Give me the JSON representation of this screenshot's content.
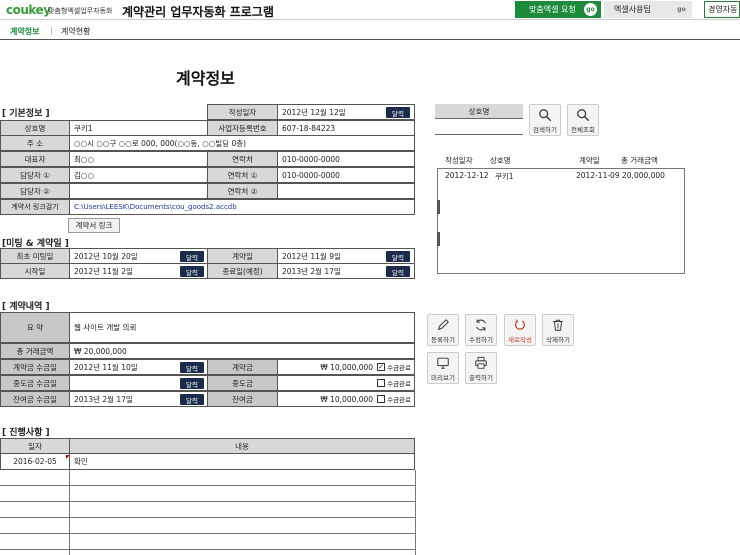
{
  "header": {
    "logo": "coukey",
    "logo_sub": "맞춤형엑셀업무자동화",
    "title": "계약관리 업무자동화 프로그램",
    "btn_custom": "맞춤엑셀 요청",
    "btn_usage": "엑셀사용팁",
    "go": "go",
    "btn_right": "경영자동"
  },
  "tabs": {
    "contract_info": "계약정보",
    "contract_status": "계약현황",
    "sep": "|"
  },
  "page_title": "계약정보",
  "basic": {
    "section": "[ 기본정보 ]",
    "written_date_label": "작성일자",
    "written_date": "2012년 12월 12일",
    "company_label": "상호명",
    "company": "쿠키1",
    "bizno_label": "사업자등록번호",
    "bizno": "607-18-84223",
    "addr_label": "주  소",
    "addr": "○○시 ○○구 ○○로 000, 000(○○동, ○○빌딩 0층)",
    "ceo_label": "대표자",
    "ceo": "최○○",
    "contact_label": "연락처",
    "ceo_contact": "010-0000-0000",
    "mgr1_label": "담당자 ①",
    "mgr1": "김○○",
    "contact1_label": "연락처 ①",
    "mgr1_contact": "010-0000-0000",
    "mgr2_label": "담당자 ②",
    "mgr2": "",
    "contact2_label": "연락처 ②",
    "mgr2_contact": "",
    "link_label": "계약서 링크걸기",
    "link_path": "C:\\Users\\LEESK\\Documents\\cou_goods2.accdb",
    "link_button": "계약서 링크"
  },
  "calendar_btn": "달력",
  "meeting": {
    "section": "[미팅 & 계약일 ]",
    "first_meeting_label": "최초 미팅일",
    "first_meeting": "2012년 10월 20일",
    "contract_date_label": "계약일",
    "contract_date": "2012년 11월 9일",
    "start_label": "시작일",
    "start": "2012년 11월 2일",
    "end_label": "종료일(예정)",
    "end": "2013년 2월 17일"
  },
  "contract": {
    "section": "[ 계약내역 ]",
    "summary_label": "요  약",
    "summary": "웹 사이트 개발 의뢰",
    "total_label": "총 거래금액",
    "total": "₩  20,000,000",
    "deposit_date_label": "계약금 수금일",
    "deposit_date": "2012년 11월 10일",
    "deposit_label": "계약금",
    "deposit_amount": "₩    10,000,000",
    "mid_date_label": "중도금 수금일",
    "mid_date": "",
    "mid_label": "중도금",
    "mid_amount": "",
    "balance_date_label": "잔여금 수금일",
    "balance_date": "2013년 2월 17일",
    "balance_label": "잔여금",
    "balance_amount": "₩    10,000,000",
    "received": "수금완료"
  },
  "progress": {
    "section": "[ 진행사항 ]",
    "col_date": "일자",
    "col_content": "내용",
    "rows": [
      {
        "date": "2016-02-05",
        "content": "확인"
      }
    ]
  },
  "search": {
    "label": "상호명",
    "search_btn": "검색하기",
    "all_btn": "전체조회"
  },
  "list": {
    "headers": [
      "작성일자",
      "상호명",
      "계약일",
      "총 거래금액"
    ],
    "rows": [
      {
        "date": "2012-12-12",
        "company": "쿠키1",
        "contract_date": "2012-11-09",
        "total": "20,000,000"
      }
    ]
  },
  "actions": {
    "register": "등록하기",
    "modify": "수정하기",
    "new": "새로작성",
    "delete": "삭제하기",
    "preview": "미리보기",
    "print": "출력하기"
  },
  "colors": {
    "green": "#1e8a3c",
    "navy": "#1c2a4c",
    "header_gray": "#d8d8d8",
    "red": "#c0392b"
  }
}
